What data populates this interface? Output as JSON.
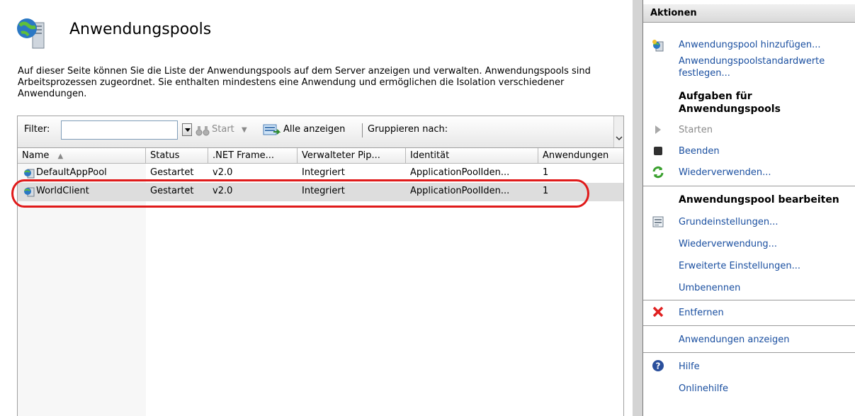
{
  "page": {
    "title": "Anwendungspools",
    "description": "Auf dieser Seite können Sie die Liste der Anwendungspools auf dem Server anzeigen und verwalten. Anwendungspools sind Arbeitsprozessen zugeordnet. Sie enthalten mindestens eine Anwendung und ermöglichen die Isolation verschiedener Anwendungen."
  },
  "toolbar": {
    "filter_label": "Filter:",
    "filter_value": "",
    "start_label": "Start",
    "show_all_label": "Alle anzeigen",
    "group_by_label": "Gruppieren nach:"
  },
  "grid": {
    "columns": [
      "Name",
      "Status",
      ".NET Frame...",
      "Verwalteter Pip...",
      "Identität",
      "Anwendungen"
    ],
    "rows": [
      {
        "name": "DefaultAppPool",
        "status": "Gestartet",
        "net": "v2.0",
        "pipeline": "Integriert",
        "identity": "ApplicationPoolIden...",
        "apps": "1"
      },
      {
        "name": "WorldClient",
        "status": "Gestartet",
        "net": "v2.0",
        "pipeline": "Integriert",
        "identity": "ApplicationPoolIden...",
        "apps": "1"
      }
    ],
    "selected_row": 1
  },
  "actions": {
    "title": "Aktionen",
    "add": "Anwendungspool hinzufügen...",
    "defaults_line1": "Anwendungspoolstandardwerte",
    "defaults_line2": "festlegen...",
    "tasks_heading_line1": "Aufgaben für",
    "tasks_heading_line2": "Anwendungspools",
    "start": "Starten",
    "stop": "Beenden",
    "recycle": "Wiederverwenden...",
    "edit_heading": "Anwendungspool bearbeiten",
    "basic_settings": "Grundeinstellungen...",
    "recycling": "Wiederverwendung...",
    "advanced_settings": "Erweiterte Einstellungen...",
    "rename": "Umbenennen",
    "remove": "Entfernen",
    "view_apps": "Anwendungen anzeigen",
    "help": "Hilfe",
    "online_help": "Onlinehilfe"
  },
  "colors": {
    "link": "#1a4fa0",
    "highlight": "#e01a1a",
    "selected_row": "#dddddd"
  }
}
